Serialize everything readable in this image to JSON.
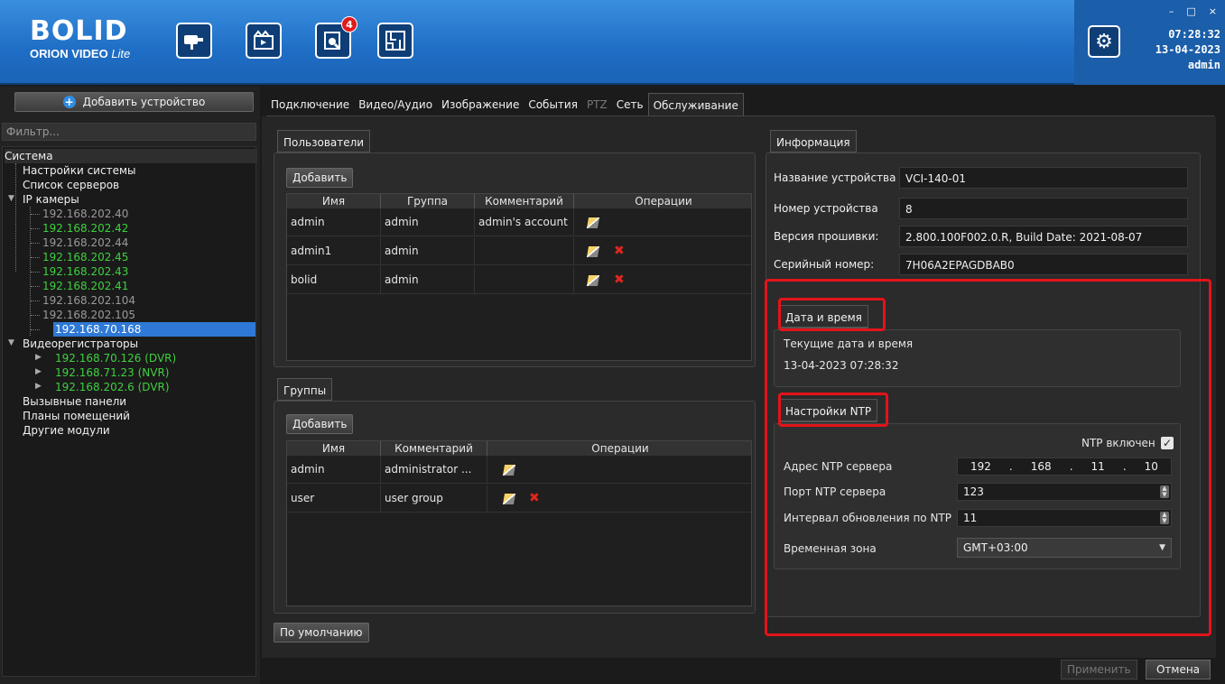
{
  "app": {
    "logo_mark": "BOLID",
    "logo_sub": "ORION VIDEO",
    "logo_sub_italic": "Lite",
    "notification_count": "4"
  },
  "status": {
    "time": "07:28:32",
    "date": "13-04-2023",
    "user": "admin",
    "win_min": "–",
    "win_max": "□",
    "win_close": "×"
  },
  "sidebar": {
    "add_device_label": "Добавить устройство",
    "filter_placeholder": "Фильтр...",
    "tree": {
      "root": "Система",
      "system_settings": "Настройки системы",
      "server_list": "Список серверов",
      "ip_cameras": "IP камеры",
      "cameras": [
        "192.168.202.40",
        "192.168.202.42",
        "192.168.202.44",
        "192.168.202.45",
        "192.168.202.43",
        "192.168.202.41",
        "192.168.202.104",
        "192.168.202.105",
        "192.168.70.168"
      ],
      "recorders": "Видеорегистраторы",
      "recorder_items": [
        "192.168.70.126 (DVR)",
        "192.168.71.23 (NVR)",
        "192.168.202.6 (DVR)"
      ],
      "call_panels": "Вызывные панели",
      "floor_plans": "Планы помещений",
      "other_modules": "Другие модули"
    }
  },
  "tabs": [
    "Подключение",
    "Видео/Аудио",
    "Изображение",
    "События",
    "PTZ",
    "Сеть",
    "Обслуживание"
  ],
  "users": {
    "title": "Пользователи",
    "add_label": "Добавить",
    "columns": [
      "Имя",
      "Группа",
      "Комментарий",
      "Операции"
    ],
    "rows": [
      {
        "name": "admin",
        "group": "admin",
        "comment": "admin's account"
      },
      {
        "name": "admin1",
        "group": "admin",
        "comment": ""
      },
      {
        "name": "bolid",
        "group": "admin",
        "comment": ""
      }
    ]
  },
  "groups": {
    "title": "Группы",
    "add_label": "Добавить",
    "columns": [
      "Имя",
      "Комментарий",
      "Операции"
    ],
    "rows": [
      {
        "name": "admin",
        "comment": "administrator ..."
      },
      {
        "name": "user",
        "comment": "user group"
      }
    ]
  },
  "default_label": "По умолчанию",
  "info": {
    "title": "Информация",
    "device_name_label": "Название устройства",
    "device_name": "VCI-140-01",
    "device_number_label": "Номер устройства",
    "device_number": "8",
    "firmware_label": "Версия прошивки:",
    "firmware": "2.800.100F002.0.R, Build Date: 2021-08-07",
    "serial_label": "Серийный номер:",
    "serial": "7H06A2EPAGDBAB0"
  },
  "datetime": {
    "title": "Дата и время",
    "current_label": "Текущие дата и время",
    "current_value": "13-04-2023 07:28:32"
  },
  "ntp": {
    "title": "Настройки NTP",
    "enabled_label": "NTP включен",
    "enabled_check": "✓",
    "server_label": "Адрес NTP сервера",
    "ip": [
      "192",
      "168",
      "11",
      "10"
    ],
    "ip_dot": ".",
    "port_label": "Порт NTP сервера",
    "port": "123",
    "interval_label": "Интервал обновления по NTP",
    "interval": "11",
    "tz_label": "Временная зона",
    "tz": "GMT+03:00"
  },
  "footer": {
    "apply": "Применить",
    "cancel": "Отмена"
  },
  "colors": {
    "accent": "#2f79d6",
    "online": "#3ed13e",
    "highlight": "#e3131a"
  }
}
